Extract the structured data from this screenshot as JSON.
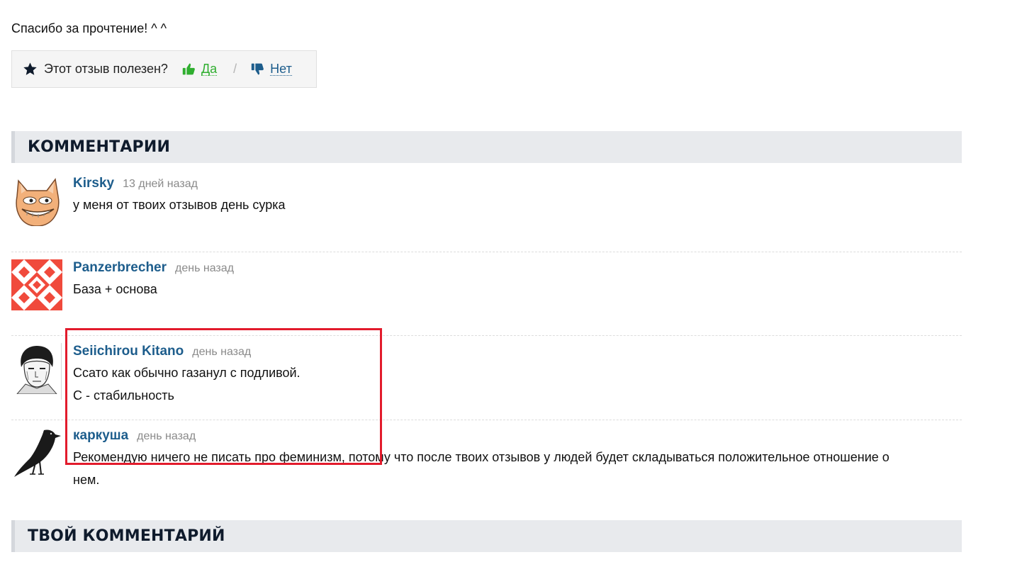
{
  "review_end": {
    "thanks_text": "Спасибо за прочтение! ^ ^"
  },
  "helpful": {
    "question": "Этот отзыв полезен?",
    "yes_label": "Да",
    "separator": "/",
    "no_label": "Нет",
    "yes_color": "#2fae2f",
    "no_color": "#1d5d8c"
  },
  "comments_section": {
    "title": "КОММЕНТАРИИ",
    "items": [
      {
        "author": "Kirsky",
        "time": "13 дней назад",
        "lines": [
          "у меня от твоих отзывов день сурка"
        ],
        "avatar": "cat-troll-face-avatar"
      },
      {
        "author": "Panzerbrecher",
        "time": "день назад",
        "lines": [
          "База + основа"
        ],
        "avatar": "red-geometric-pattern-avatar"
      },
      {
        "author": "Seiichirou Kitano",
        "time": "день назад",
        "lines": [
          "Ссато как обычно газанул с подливой.",
          "С - стабильность"
        ],
        "avatar": "manga-portrait-avatar"
      },
      {
        "author": "каркуша",
        "time": "день назад",
        "lines": [
          "Рекомендую ничего не писать про феминизм, потому что после твоих отзывов у людей будет складываться положительное отношение о",
          "нем."
        ],
        "avatar": "crow-avatar"
      }
    ]
  },
  "your_comment_section": {
    "title": "ТВОЙ КОММЕНТАРИЙ"
  },
  "colors": {
    "author_link": "#1d5d8c",
    "highlight_border": "#e21b2c",
    "section_bg": "#e8eaed"
  }
}
